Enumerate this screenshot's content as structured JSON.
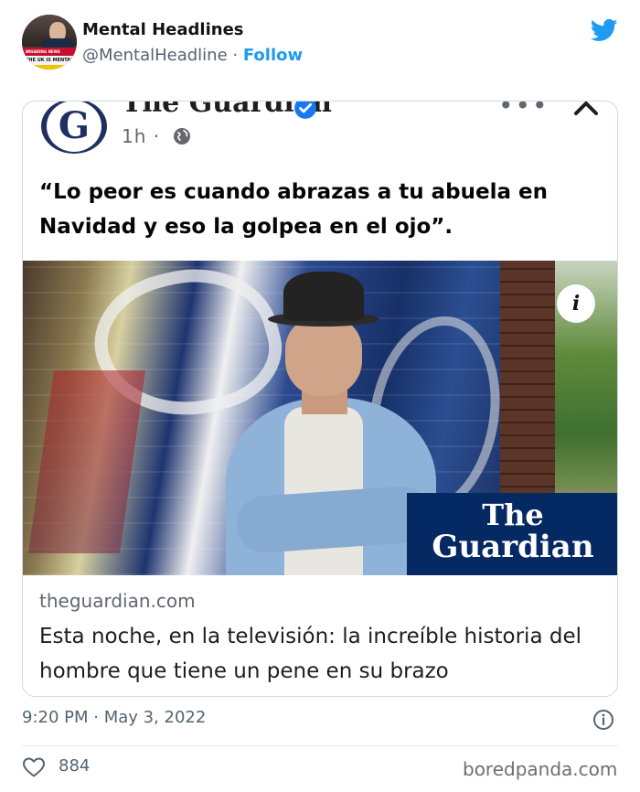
{
  "tweet": {
    "author_name": "Mental Headlines",
    "author_handle": "@MentalHeadline",
    "separator": "·",
    "follow_label": "Follow",
    "avatar_banner_top": "BREAKING NEWS",
    "avatar_banner_main": "THE UK IS MENTAL",
    "timestamp": "9:20 PM · May 3, 2022",
    "likes_count": "884",
    "brand_color": "#1d9bf0"
  },
  "embedded_post": {
    "page_name": "The Guardian",
    "time_label": "1h",
    "time_separator": "·",
    "logo_letter": "G",
    "quote": "“Lo peor es cuando abrazas a tu abuela en Navidad y eso la golpea en el ojo”.",
    "info_badge": "i",
    "image_brand_line1": "The",
    "image_brand_line2": "Guardian",
    "link_domain": "theguardian.com",
    "link_title": "Esta noche, en la televisión: la increíble historia del hombre que tiene un pene en su brazo",
    "guardian_navy": "#052962"
  },
  "watermark": "boredpanda.com",
  "icons": {
    "twitter": "twitter-bird-icon",
    "verified": "verified-badge-icon",
    "more": "more-dots-icon",
    "close": "close-chevron-icon",
    "globe": "globe-icon",
    "info": "info-icon",
    "heart": "heart-icon"
  }
}
